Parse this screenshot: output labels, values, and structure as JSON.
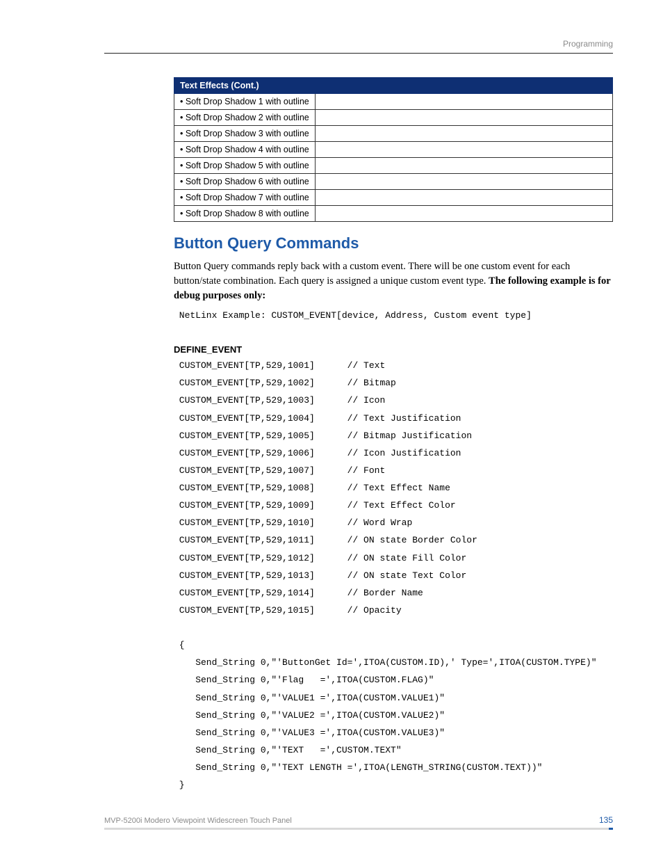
{
  "sectionHeader": "Programming",
  "table": {
    "header": "Text Effects (Cont.)",
    "rows": [
      "• Soft Drop Shadow 1 with outline",
      "• Soft Drop Shadow 2 with outline",
      "• Soft Drop Shadow 3 with outline",
      "• Soft Drop Shadow 4 with outline",
      "• Soft Drop Shadow 5 with outline",
      "• Soft Drop Shadow 6 with outline",
      "• Soft Drop Shadow 7 with outline",
      "• Soft Drop Shadow 8 with outline"
    ]
  },
  "heading": "Button Query Commands",
  "para1a": "Button Query commands reply back with a custom event. There will be one custom event for each button/state combination. Each query is assigned a unique custom event type. ",
  "para1b": "The following example is for debug purposes only:",
  "exampleLine": " NetLinx Example: CUSTOM_EVENT[device, Address, Custom event type]",
  "defineEvent": "DEFINE_EVENT",
  "events": [
    " CUSTOM_EVENT[TP,529,1001]      // Text",
    " CUSTOM_EVENT[TP,529,1002]      // Bitmap",
    " CUSTOM_EVENT[TP,529,1003]      // Icon",
    " CUSTOM_EVENT[TP,529,1004]      // Text Justification",
    " CUSTOM_EVENT[TP,529,1005]      // Bitmap Justification",
    " CUSTOM_EVENT[TP,529,1006]      // Icon Justification",
    " CUSTOM_EVENT[TP,529,1007]      // Font",
    " CUSTOM_EVENT[TP,529,1008]      // Text Effect Name",
    " CUSTOM_EVENT[TP,529,1009]      // Text Effect Color",
    " CUSTOM_EVENT[TP,529,1010]      // Word Wrap",
    " CUSTOM_EVENT[TP,529,1011]      // ON state Border Color",
    " CUSTOM_EVENT[TP,529,1012]      // ON state Fill Color",
    " CUSTOM_EVENT[TP,529,1013]      // ON state Text Color",
    " CUSTOM_EVENT[TP,529,1014]      // Border Name",
    " CUSTOM_EVENT[TP,529,1015]      // Opacity"
  ],
  "block": [
    " {",
    "    Send_String 0,\"'ButtonGet Id=',ITOA(CUSTOM.ID),' Type=',ITOA(CUSTOM.TYPE)\"",
    "    Send_String 0,\"'Flag   =',ITOA(CUSTOM.FLAG)\"",
    "    Send_String 0,\"'VALUE1 =',ITOA(CUSTOM.VALUE1)\"",
    "    Send_String 0,\"'VALUE2 =',ITOA(CUSTOM.VALUE2)\"",
    "    Send_String 0,\"'VALUE3 =',ITOA(CUSTOM.VALUE3)\"",
    "    Send_String 0,\"'TEXT   =',CUSTOM.TEXT\"",
    "    Send_String 0,\"'TEXT LENGTH =',ITOA(LENGTH_STRING(CUSTOM.TEXT))\"",
    " }"
  ],
  "footerText": "MVP-5200i Modero Viewpoint Widescreen Touch Panel",
  "pageNumber": "135"
}
